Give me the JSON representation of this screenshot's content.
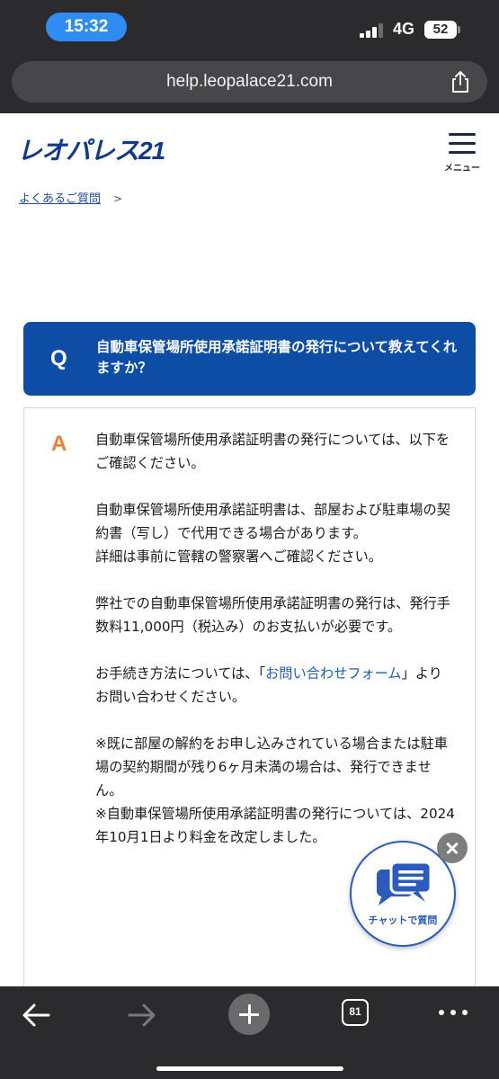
{
  "status_bar": {
    "time": "15:32",
    "network": "4G",
    "battery": "52",
    "battery_level": 0.52
  },
  "browser": {
    "url": "help.leopalace21.com",
    "tab_count": "81"
  },
  "site": {
    "logo_text": "レオパレス21",
    "menu_label": "メニュー"
  },
  "breadcrumb": {
    "link": "よくあるご質問",
    "separator": ">"
  },
  "question": {
    "mark": "Q",
    "text": "自動車保管場所使用承諾証明書の発行について教えてくれますか？"
  },
  "answer": {
    "mark": "A",
    "p1": "自動車保管場所使用承諾証明書の発行については、以下をご確認ください。",
    "p2": "自動車保管場所使用承諾証明書は、部屋および駐車場の契約書（写し）で代用できる場合があります。",
    "p3": "詳細は事前に管轄の警察署へご確認ください。",
    "p4": "弊社での自動車保管場所使用承諾証明書の発行は、発行手数料11,000円（税込み）のお支払いが必要です。",
    "p5_pre": "お手続き方法については、「",
    "p5_link": "お問い合わせフォーム",
    "p5_post": "」よりお問い合わせください。",
    "p6": "※既に部屋の解約をお申し込みされている場合または駐車場の契約期間が残り6ヶ月未満の場合は、発行できません。",
    "p7": "※自動車保管場所使用承諾証明書の発行については、2024年10月1日より料金を改定しました。"
  },
  "chat": {
    "label": "チャットで質問"
  },
  "icons": {
    "share": "share-icon",
    "back": "back-arrow-icon",
    "forward": "forward-arrow-icon",
    "new_tab": "plus-icon",
    "more": "more-dots-icon",
    "chat": "chat-bubble-icon",
    "close": "close-icon"
  }
}
